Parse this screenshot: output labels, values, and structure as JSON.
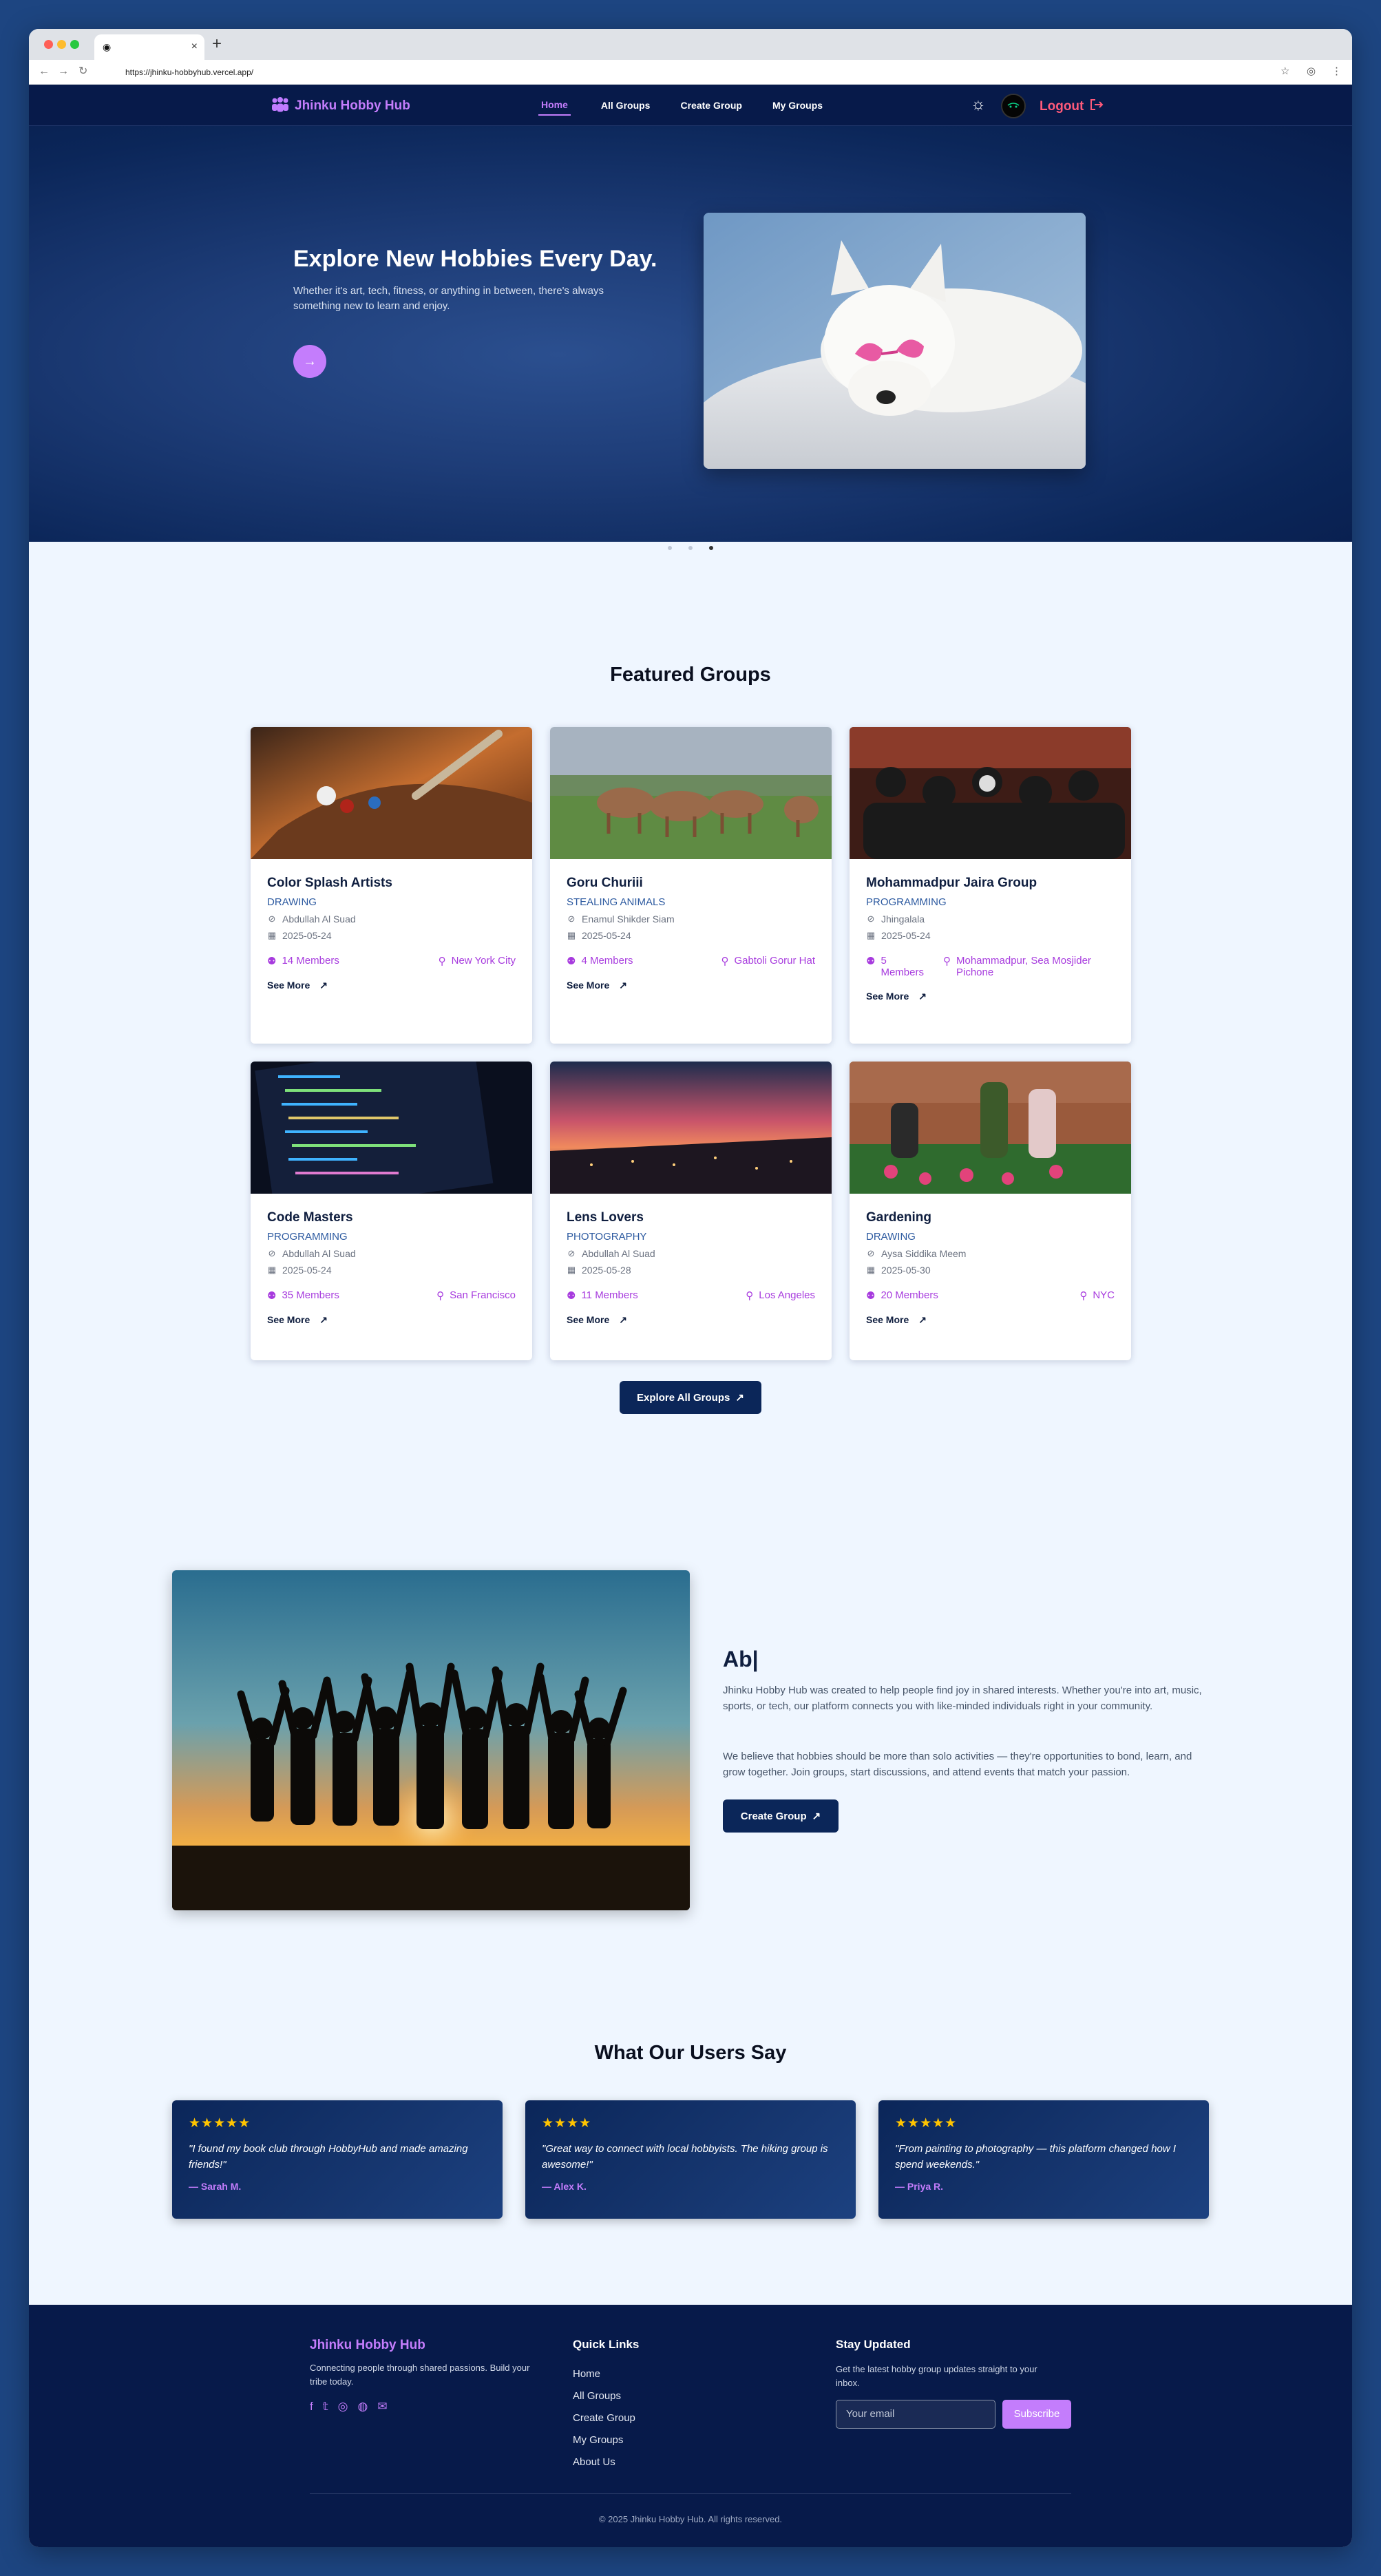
{
  "browser": {
    "url": "https://jhinku-hobbyhub.vercel.app/",
    "tab_close": "×",
    "new_tab": "+"
  },
  "nav": {
    "brand": "Jhinku Hobby Hub",
    "links": [
      "Home",
      "All Groups",
      "Create Group",
      "My Groups"
    ],
    "logout": "Logout"
  },
  "hero": {
    "title": "Explore New Hobbies Every Day.",
    "subtitle": "Whether it's art, tech, fitness, or anything in between, there's always something new to learn and enjoy.",
    "button_icon": "→"
  },
  "featured": {
    "title": "Featured Groups",
    "explore_label": "Explore All Groups",
    "groups": [
      {
        "name": "Color Splash Artists",
        "category": "DRAWING",
        "owner": "Abdullah Al Suad",
        "date": "2025-05-24",
        "members": "14 Members",
        "location": "New York City"
      },
      {
        "name": "Goru Churiii",
        "category": "STEALING ANIMALS",
        "owner": "Enamul Shikder Siam",
        "date": "2025-05-24",
        "members": "4 Members",
        "location": "Gabtoli Gorur Hat"
      },
      {
        "name": "Mohammadpur Jaira Group",
        "category": "PROGRAMMING",
        "owner": "Jhingalala",
        "date": "2025-05-24",
        "members": "5 Members",
        "location": "Mohammadpur, Sea Mosjider Pichone"
      },
      {
        "name": "Code Masters",
        "category": "PROGRAMMING",
        "owner": "Abdullah Al Suad",
        "date": "2025-05-24",
        "members": "35 Members",
        "location": "San Francisco"
      },
      {
        "name": "Lens Lovers",
        "category": "PHOTOGRAPHY",
        "owner": "Abdullah Al Suad",
        "date": "2025-05-28",
        "members": "11 Members",
        "location": "Los Angeles"
      },
      {
        "name": "Gardening",
        "category": "DRAWING",
        "owner": "Aysa Siddika Meem",
        "date": "2025-05-30",
        "members": "20 Members",
        "location": "NYC"
      }
    ],
    "see_more": "See More"
  },
  "about": {
    "title": "Ab|",
    "p1": "Jhinku Hobby Hub was created to help people find joy in shared interests. Whether you're into art, music, sports, or tech, our platform connects you with like-minded individuals right in your community.",
    "p2": "We believe that hobbies should be more than solo activities — they're opportunities to bond, learn, and grow together. Join groups, start discussions, and attend events that match your passion.",
    "button": "Create Group"
  },
  "testimonials": {
    "title": "What Our Users Say",
    "items": [
      {
        "stars": "★★★★★",
        "quote": "\"I found my book club through HobbyHub and made amazing friends!\"",
        "author": "— Sarah M."
      },
      {
        "stars": "★★★★",
        "quote": "\"Great way to connect with local hobbyists. The hiking group is awesome!\"",
        "author": "— Alex K."
      },
      {
        "stars": "★★★★★",
        "quote": "\"From painting to photography — this platform changed how I spend weekends.\"",
        "author": "— Priya R."
      }
    ]
  },
  "footer": {
    "brand": "Jhinku Hobby Hub",
    "desc": "Connecting people through shared passions. Build your tribe today.",
    "quick_links_title": "Quick Links",
    "links": [
      "Home",
      "All Groups",
      "Create Group",
      "My Groups",
      "About Us"
    ],
    "newsletter_title": "Stay Updated",
    "newsletter_desc": "Get the latest hobby group updates straight to your inbox.",
    "email_placeholder": "Your email",
    "subscribe": "Subscribe",
    "copyright": "© 2025 Jhinku Hobby Hub. All rights reserved."
  },
  "colors": {
    "accent": "#c47dfc",
    "navy": "#071a4a",
    "logout": "#ff5a7a",
    "star": "#ffc400"
  }
}
